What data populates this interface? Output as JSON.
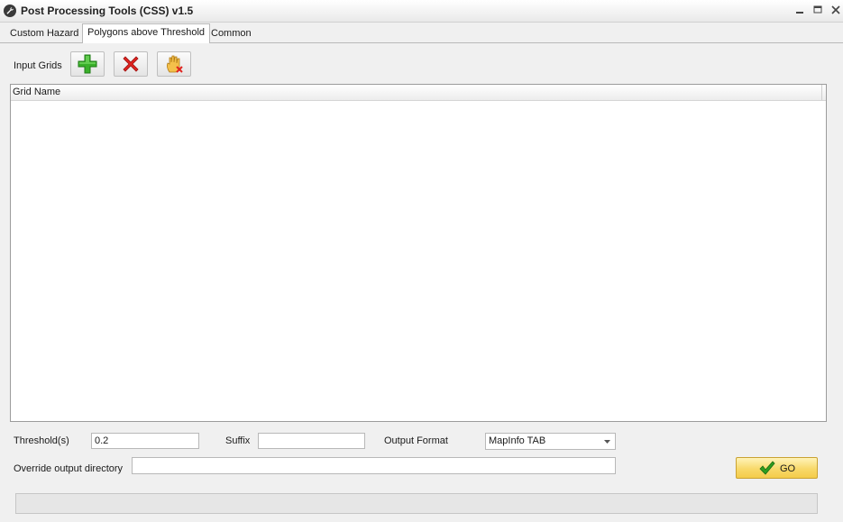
{
  "window": {
    "title": "Post Processing Tools (CSS) v1.5",
    "app_icon": "wrench-icon",
    "controls": [
      "minimize-icon",
      "maximize-icon",
      "close-icon"
    ]
  },
  "tabs": [
    {
      "label": "Custom Hazard",
      "active": false
    },
    {
      "label": "Polygons above Threshold",
      "active": true
    },
    {
      "label": "Common",
      "active": false
    }
  ],
  "toolbar": {
    "input_grids_label": "Input Grids",
    "buttons": [
      {
        "icon": "plus-icon",
        "color": "#3ab02a"
      },
      {
        "icon": "red-x-icon",
        "color": "#e0231f"
      },
      {
        "icon": "hand-clear-icon",
        "color": "#e8a92a"
      }
    ]
  },
  "grid": {
    "columns": [
      "Grid Name"
    ],
    "rows": []
  },
  "form": {
    "threshold_label": "Threshold(s)",
    "threshold_value": "0.2",
    "suffix_label": "Suffix",
    "suffix_value": "",
    "output_format_label": "Output Format",
    "output_format_value": "MapInfo TAB",
    "override_dir_label": "Override output directory",
    "override_dir_value": ""
  },
  "go_button": {
    "label": "GO",
    "icon": "checkmark-icon"
  },
  "progress": {
    "value": 0
  }
}
